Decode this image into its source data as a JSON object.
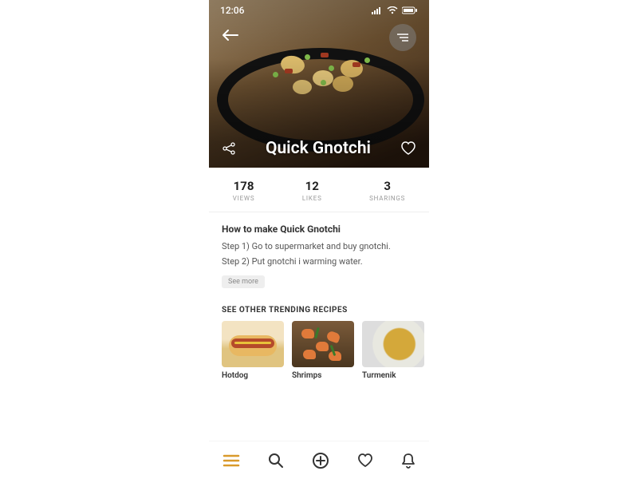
{
  "status": {
    "time": "12:06"
  },
  "hero": {
    "title": "Quick Gnotchi"
  },
  "stats": [
    {
      "value": "178",
      "label": "VIEWS"
    },
    {
      "value": "12",
      "label": "LIKES"
    },
    {
      "value": "3",
      "label": "SHARINGS"
    }
  ],
  "howto": {
    "title": "How to make Quick Gnotchi",
    "steps": [
      "Step 1) Go to supermarket and buy gnotchi.",
      "Step 2) Put gnotchi i warming water."
    ],
    "see_more": "See more"
  },
  "trending": {
    "heading": "SEE OTHER TRENDING RECIPES",
    "cards": [
      {
        "name": "Hotdog"
      },
      {
        "name": "Shrimps"
      },
      {
        "name": "Turmenik"
      }
    ]
  }
}
